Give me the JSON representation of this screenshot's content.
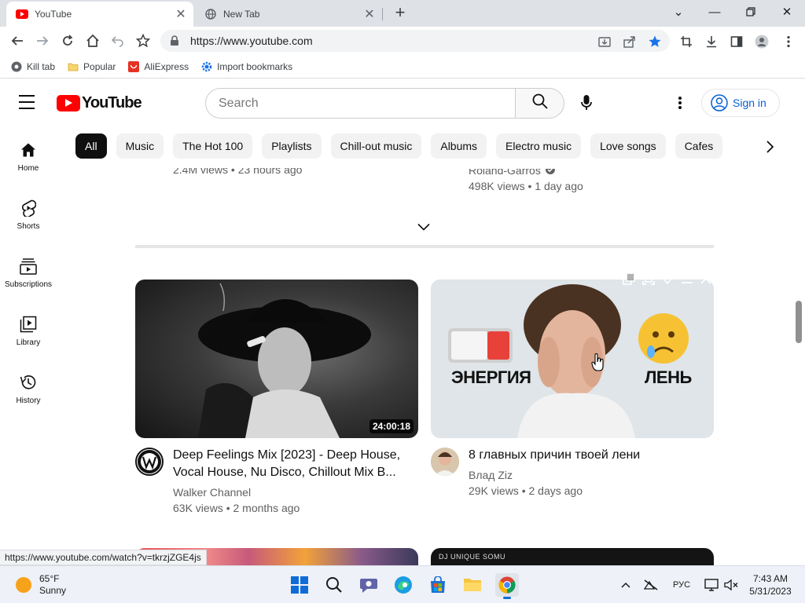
{
  "browser": {
    "tabs": [
      {
        "title": "YouTube",
        "active": true
      },
      {
        "title": "New Tab",
        "active": false
      }
    ],
    "url": "https://www.youtube.com",
    "bookmarks": [
      {
        "label": "Kill tab",
        "icon": "chrome-globe-icon"
      },
      {
        "label": "Popular",
        "icon": "folder-icon"
      },
      {
        "label": "AliExpress",
        "icon": "aliexpress-icon"
      },
      {
        "label": "Import bookmarks",
        "icon": "gear-icon"
      }
    ],
    "status_url": "https://www.youtube.com/watch?v=tkrzjZGE4js"
  },
  "youtube": {
    "logo_text": "YouTube",
    "search_placeholder": "Search",
    "sign_in": "Sign in",
    "chips": [
      "All",
      "Music",
      "The Hot 100",
      "Playlists",
      "Chill-out music",
      "Albums",
      "Electro music",
      "Love songs",
      "Cafes"
    ],
    "guide": [
      {
        "label": "Home",
        "icon": "home-icon"
      },
      {
        "label": "Shorts",
        "icon": "shorts-icon"
      },
      {
        "label": "Subscriptions",
        "icon": "subscriptions-icon"
      },
      {
        "label": "Library",
        "icon": "library-icon"
      },
      {
        "label": "History",
        "icon": "history-icon"
      }
    ],
    "partial_top": {
      "left_meta": "2.4M views • 23 hours ago",
      "right_channel": "Roland-Garros",
      "right_meta": "498K views • 1 day ago"
    },
    "videos": [
      {
        "title": "Deep Feelings Mix [2023] - Deep House, Vocal House, Nu Disco, Chillout Mix B...",
        "channel": "Walker Channel",
        "stats": "63K views • 2 months ago",
        "duration": "24:00:18"
      },
      {
        "title": "8 главных причин твоей лени",
        "channel": "Влад Ziz",
        "stats": "29K views • 2 days ago",
        "thumb_text_left": "ЭНЕРГИЯ",
        "thumb_text_right": "ЛЕНЬ"
      }
    ],
    "partial_bottom_right_text": "DJ UNIQUE SOMU"
  },
  "taskbar": {
    "weather_temp": "65°F",
    "weather_desc": "Sunny",
    "lang": "РУС",
    "time": "7:43 AM",
    "date": "5/31/2023"
  },
  "colors": {
    "youtube_red": "#ff0000",
    "link_blue": "#065fd4",
    "chrome_tab_bg": "#dee1e6"
  }
}
